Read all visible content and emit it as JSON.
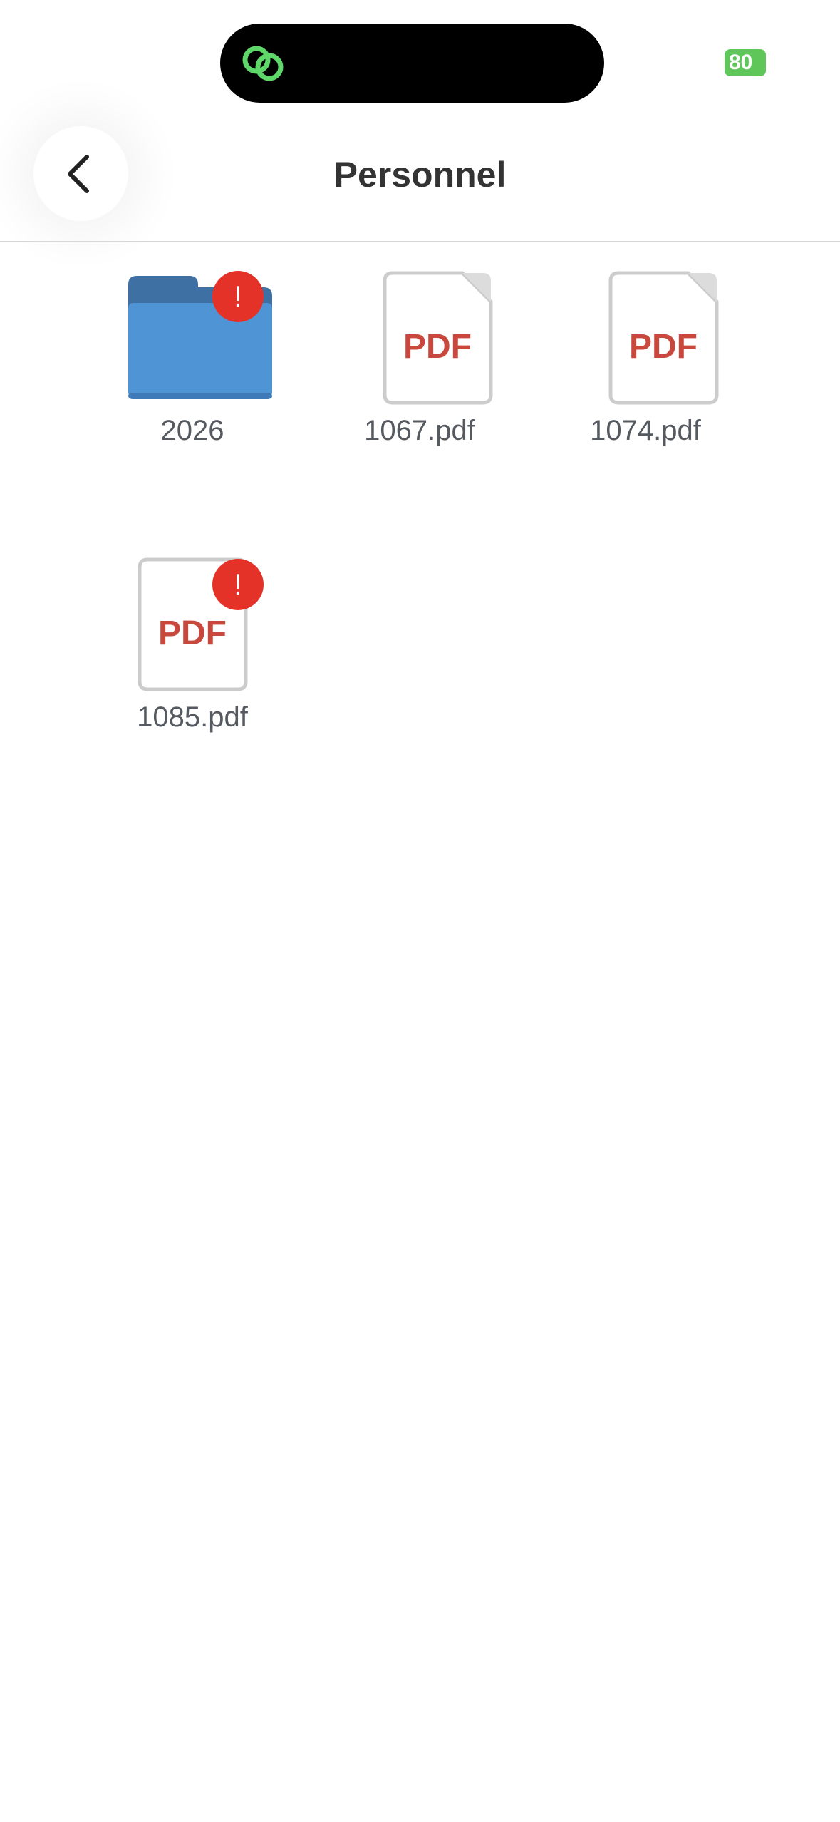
{
  "status_bar": {
    "battery_level": "80",
    "battery_color": "#5fc65a",
    "island_icon": "link-rings-icon"
  },
  "header": {
    "title": "Personnel",
    "back_icon": "chevron-left-icon"
  },
  "files": [
    {
      "name": "2026",
      "type": "folder",
      "has_alert": true,
      "icon": "folder-icon"
    },
    {
      "name": "1067.pdf",
      "type": "pdf",
      "has_alert": false,
      "icon_text": "PDF"
    },
    {
      "name": "1074.pdf",
      "type": "pdf",
      "has_alert": false,
      "icon_text": "PDF"
    },
    {
      "name": "1085.pdf",
      "type": "pdf",
      "has_alert": true,
      "icon_text": "PDF"
    }
  ],
  "alert_badge_text": "!",
  "colors": {
    "folder_front": "#4f95d6",
    "folder_back": "#3f70a3",
    "pdf_text": "#c9483e",
    "alert": "#e53228"
  }
}
